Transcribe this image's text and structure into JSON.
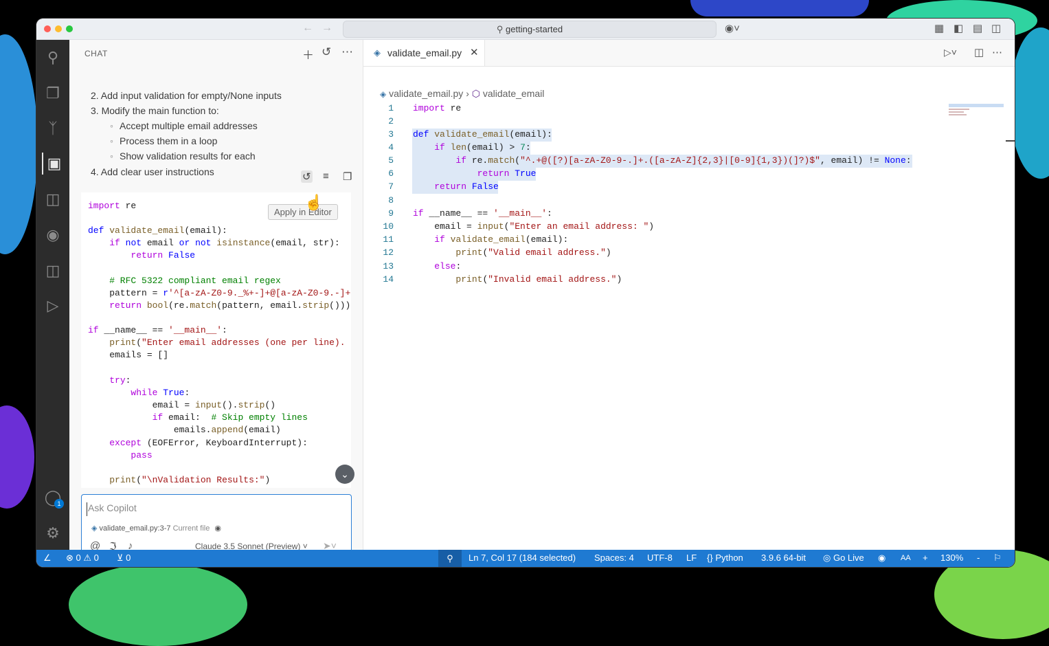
{
  "window": {
    "command_center": "getting-started"
  },
  "chat": {
    "title": "CHAT",
    "markdown": [
      "2. Add input validation for empty/None inputs",
      "3. Modify the main function to:",
      "Accept multiple email addresses",
      "Process them in a loop",
      "Show validation results for each",
      "4. Add clear user instructions"
    ],
    "code": [
      "import re",
      "",
      "def validate_email(email):",
      "    if not email or not isinstance(email, str):",
      "        return False",
      "",
      "    # RFC 5322 compliant email regex",
      "    pattern = r'^[a-zA-Z0-9._%+-]+@[a-zA-Z0-9.-]+",
      "    return bool(re.match(pattern, email.strip()))",
      "",
      "if __name__ == '__main__':",
      "    print(\"Enter email addresses (one per line).",
      "    emails = []",
      "",
      "    try:",
      "        while True:",
      "            email = input().strip()",
      "            if email:  # Skip empty lines",
      "                emails.append(email)",
      "    except (EOFError, KeyboardInterrupt):",
      "        pass",
      "",
      "    print(\"\\nValidation Results:\")"
    ],
    "tooltip": "Apply in Editor",
    "input_placeholder": "Ask Copilot",
    "attachment_file": "validate_email.py",
    "attachment_range": ":3-7",
    "attachment_note": "Current file",
    "model": "Claude 3.5 Sonnet (Preview)"
  },
  "editor": {
    "tab": "validate_email.py",
    "breadcrumb_file": "validate_email.py",
    "breadcrumb_symbol": "validate_email",
    "lines": [
      "import re",
      "",
      "def validate_email(email):",
      "    if len(email) > 7:",
      "        if re.match(\"^.+@([?)[a-zA-Z0-9-.]+.([a-zA-Z]{2,3}|[0-9]{1,3})(]?)$\", email) != None:",
      "            return True",
      "    return False",
      "",
      "if __name__ == '__main__':",
      "    email = input(\"Enter an email address: \")",
      "    if validate_email(email):",
      "        print(\"Valid email address.\")",
      "    else:",
      "        print(\"Invalid email address.\")"
    ],
    "line_numbers": [
      "1",
      "2",
      "3",
      "4",
      "5",
      "6",
      "7",
      "8",
      "9",
      "10",
      "11",
      "12",
      "13",
      "14"
    ]
  },
  "status": {
    "errors": "0",
    "warnings": "0",
    "ports": "0",
    "position": "Ln 7, Col 17 (184 selected)",
    "spaces": "Spaces: 4",
    "encoding": "UTF-8",
    "eol": "LF",
    "language": "Python",
    "interpreter": "3.9.6 64-bit",
    "golive": "Go Live",
    "font_size": "AA",
    "zoom": "130%"
  },
  "activity_badge": "1",
  "colors": {
    "accent": "#1f7ad2",
    "activitybar": "#2c2c2c",
    "selection": "#dde8f6"
  }
}
